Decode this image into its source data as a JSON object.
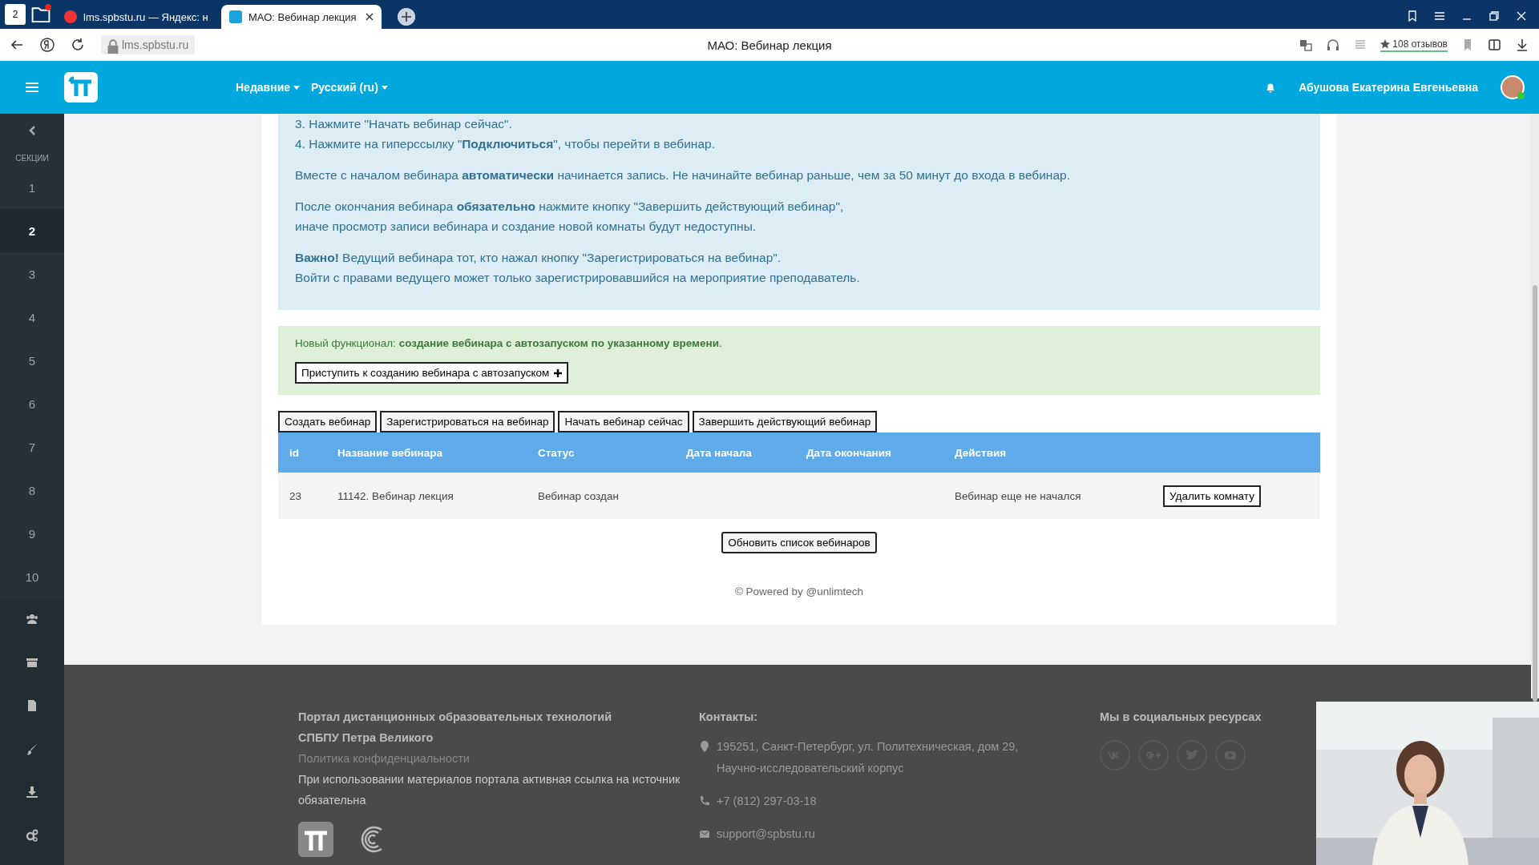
{
  "browser": {
    "tab_count": "2",
    "tabs": [
      {
        "title": "lms.spbstu.ru — Яндекс: н",
        "selected": false,
        "kind": "yandex"
      },
      {
        "title": "МАО: Вебинар лекция",
        "selected": true,
        "kind": "site"
      }
    ],
    "address": "lms.spbstu.ru",
    "page_title": "МАО: Вебинар лекция",
    "reviews": "108 отзывов"
  },
  "header": {
    "menus": [
      "Недавние",
      "Русский (ru)"
    ],
    "user_name": "Абушова Екатерина Евгеньевна"
  },
  "sidebar": {
    "title": "СЕКЦИИ",
    "sections": [
      {
        "label": "1",
        "selected": false
      },
      {
        "label": "2",
        "selected": true
      },
      {
        "label": "3",
        "selected": false
      },
      {
        "label": "4",
        "selected": false
      },
      {
        "label": "5",
        "selected": false
      },
      {
        "label": "6",
        "selected": false
      },
      {
        "label": "7",
        "selected": false
      },
      {
        "label": "8",
        "selected": false
      },
      {
        "label": "9",
        "selected": false
      },
      {
        "label": "10",
        "selected": false
      }
    ]
  },
  "info_box": {
    "paragraphs": [
      [
        "3. Нажмите \"Начать вебинар сейчас\".",
        "4. Нажмите на гиперссылку \"**Подключиться**\", чтобы перейти в вебинар."
      ],
      [
        "Вместе с началом вебинара **автоматически** начинается запись. Не начинайте вебинар раньше, чем за 50 минут до входа в вебинар."
      ],
      [
        "После окончания вебинара **обязательно** нажмите кнопку \"Завершить действующий вебинар\",",
        "иначе просмотр записи вебинара и создание новой комнаты будут недоступны."
      ],
      [
        "**Важно!** Ведущий вебинара тот, кто нажал кнопку \"Зарегистрироваться на вебинар\".",
        "Войти с правами ведущего может только зарегистрировавшийся на мероприятие преподаватель."
      ]
    ]
  },
  "notice": {
    "text": "Новый функционал: **создание вебинара с автозапуском по указанному времени**.",
    "button": "Приступить к созданию вебинара с автозапуском"
  },
  "actions": [
    "Создать вебинар",
    "Зарегистрироваться на вебинар",
    "Начать вебинар сейчас",
    "Завершить действующий вебинар"
  ],
  "table": {
    "columns": [
      "id",
      "Название вебинара",
      "Статус",
      "Дата начала",
      "Дата окончания",
      "Действия"
    ],
    "rows": [
      {
        "cells": [
          "23",
          "11142. Вебинар лекция",
          "Вебинар создан",
          "",
          "",
          "Вебинар еще не начался"
        ],
        "action": "Удалить комнату"
      }
    ]
  },
  "refresh_button": "Обновить список вебинаров",
  "powered_by": "© Powered by @unlimtech",
  "footer": {
    "title": "Портал дистанционных образовательных технологий",
    "subtitle": "СПБПУ Петра Великого",
    "privacy_link": "Политика конфиденциальности",
    "note": "При использовании материалов портала активная ссылка на источник обязательна",
    "contacts_title": "Контакты:",
    "address": "195251, Санкт-Петербург, ул. Политехническая, дом 29, Научно-исследовательский корпус",
    "phone": "+7 (812) 297-03-18",
    "email": "support@spbstu.ru",
    "social_title": "Мы в социальных ресурсах"
  }
}
